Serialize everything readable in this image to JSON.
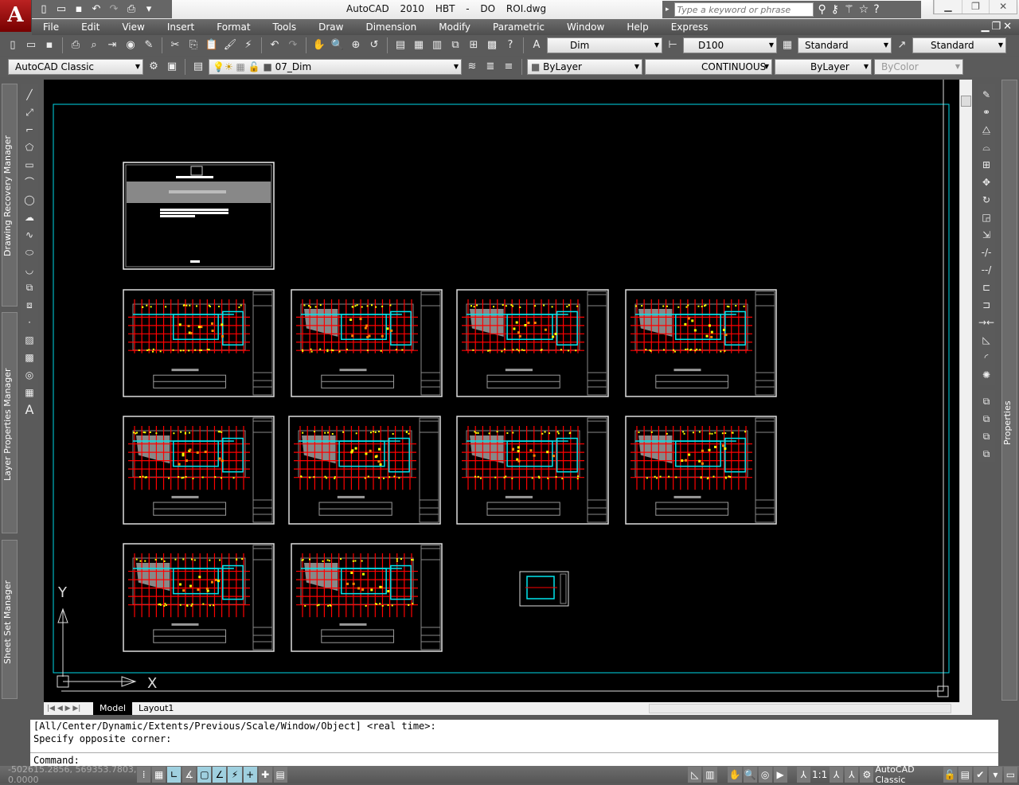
{
  "app": {
    "name": "AutoCAD 2010",
    "file": "HBT - DO ROI.dwg",
    "logo": "A"
  },
  "search": {
    "placeholder": "Type a keyword or phrase"
  },
  "menu": [
    "File",
    "Edit",
    "View",
    "Insert",
    "Format",
    "Tools",
    "Draw",
    "Dimension",
    "Modify",
    "Parametric",
    "Window",
    "Help",
    "Express"
  ],
  "styles": {
    "text_style": "Dim",
    "dim_style": "D100",
    "table_style": "Standard",
    "multileader_style": "Standard"
  },
  "workspace": {
    "name": "AutoCAD Classic",
    "layer": "07_Dim"
  },
  "properties": {
    "color": "ByLayer",
    "linetype": "CONTINUOUS",
    "lineweight": "ByLayer",
    "plotstyle": "ByColor"
  },
  "palettes": {
    "left": [
      "Drawing Recovery Manager",
      "Layer Properties Manager",
      "Sheet Set Manager"
    ],
    "right": "Properties"
  },
  "ucs": {
    "x": "X",
    "y": "Y"
  },
  "tabs": [
    "Model",
    "Layout1"
  ],
  "command": {
    "lines": [
      "[All/Center/Dynamic/Extents/Previous/Scale/Window/Object] <real time>:",
      "Specify opposite corner:"
    ],
    "prompt": "Command:"
  },
  "status": {
    "coords": "-502615.2856, 569353.7803, 0.0000",
    "annotation_scale": "1:1",
    "workspace": "AutoCAD Classic"
  },
  "colors": {
    "canvas": "#000000",
    "limits": "#00d8e8",
    "walls": "#00e5ee",
    "grid": "#ff0000",
    "dims": "#ffff00"
  }
}
